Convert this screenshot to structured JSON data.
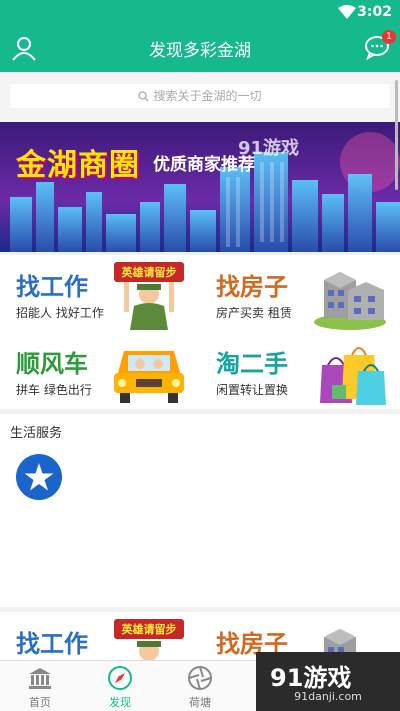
{
  "status": {
    "time": "3:02"
  },
  "header": {
    "title": "发现多彩金湖",
    "chat_badge": "1"
  },
  "search": {
    "placeholder": "搜索关于金湖的一切"
  },
  "banner": {
    "headline": "金湖商圈",
    "tagline": "优质商家推荐",
    "watermark": "91游戏"
  },
  "categories": [
    {
      "title": "找工作",
      "subtitle": "招能人 找好工作",
      "color": "#2a6fc7",
      "icon": "recruit-sign-icon",
      "sign": "英雄请留步"
    },
    {
      "title": "找房子",
      "subtitle": "房产买卖 租赁",
      "color": "#d2691e",
      "icon": "buildings-icon"
    },
    {
      "title": "顺风车",
      "subtitle": "拼车 绿色出行",
      "color": "#2e9a3b",
      "icon": "car-icon"
    },
    {
      "title": "淘二手",
      "subtitle": "闲置转让置换",
      "color": "#14a3a3",
      "icon": "shopping-bags-icon"
    }
  ],
  "life_services": {
    "title": "生活服务",
    "icon": "star-icon"
  },
  "tabs": [
    {
      "label": "首页",
      "icon": "bank-icon",
      "active": false
    },
    {
      "label": "发现",
      "icon": "compass-icon",
      "active": true
    },
    {
      "label": "荷塘",
      "icon": "aperture-icon",
      "active": false
    }
  ],
  "site_watermark": {
    "logo": "91游戏",
    "url": "91danji.com"
  },
  "accent": "#16b98b"
}
